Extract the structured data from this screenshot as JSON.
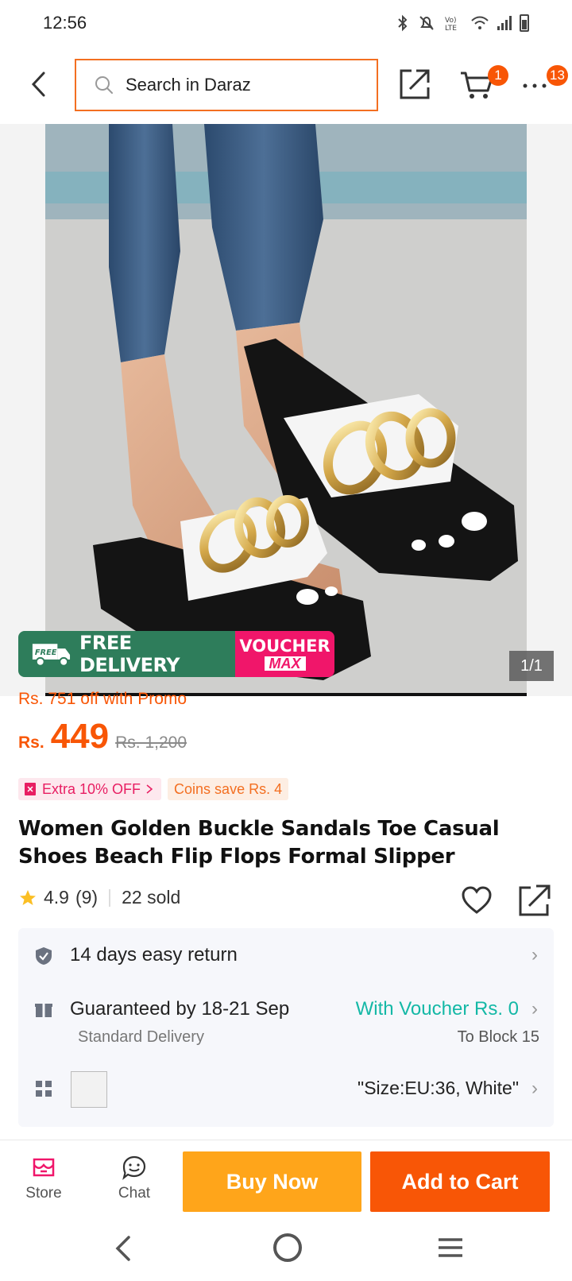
{
  "status_bar": {
    "time": "12:56"
  },
  "header": {
    "search_placeholder": "Search in Daraz",
    "cart_badge": "1",
    "more_badge": "13"
  },
  "gallery": {
    "promo_free": "FREE DELIVERY",
    "promo_free_icon_text": "FREE",
    "promo_voucher_line1": "VOUCHER",
    "promo_voucher_line2": "MAX",
    "counter": "1/1"
  },
  "price": {
    "promo_off": "Rs. 751 off with Promo",
    "currency": "Rs.",
    "value": "449",
    "original": "Rs. 1,200",
    "tag_extra": "Extra 10% OFF",
    "tag_coins": "Coins save Rs. 4"
  },
  "product": {
    "title": "Women Golden Buckle Sandals Toe Casual Shoes Beach Flip Flops Formal Slipper",
    "rating": "4.9",
    "reviews": "(9)",
    "sold": "22 sold"
  },
  "info": {
    "return_text": "14 days easy return",
    "delivery_text": "Guaranteed by 18-21 Sep",
    "delivery_sub": "Standard Delivery",
    "voucher_text": "With Voucher Rs. 0",
    "block_text": "To Block 15",
    "variant_text": "\"Size:EU:36, White\""
  },
  "actions": {
    "store_label": "Store",
    "chat_label": "Chat",
    "buy_now": "Buy Now",
    "add_to_cart": "Add to Cart"
  },
  "colors": {
    "brand_orange": "#f85606",
    "buy_now_yellow": "#ffa51a",
    "free_delivery_green": "#2e7d5b",
    "voucher_pink": "#f0166a",
    "voucher_teal": "#14b8a6"
  }
}
